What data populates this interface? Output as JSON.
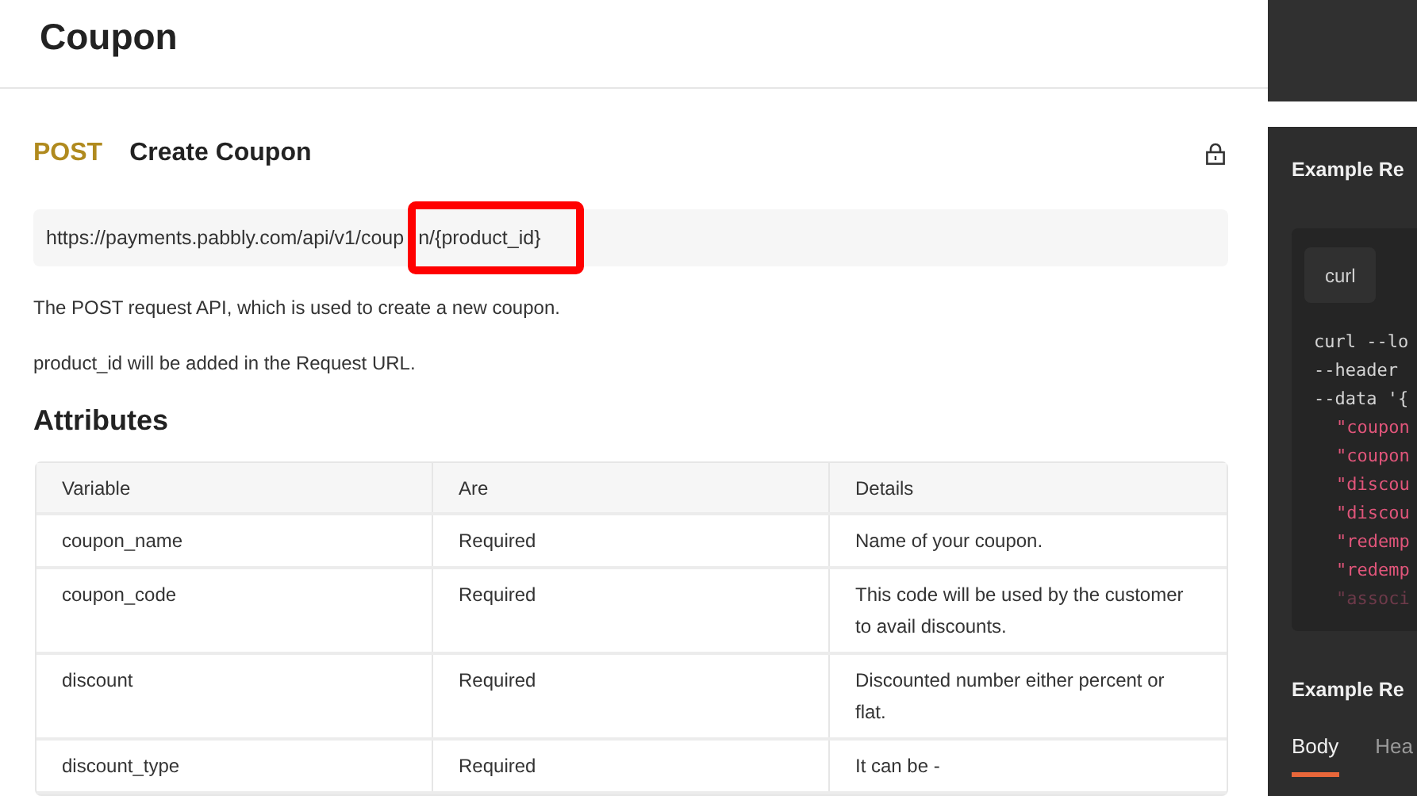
{
  "page_title": "Coupon",
  "endpoint": {
    "method": "POST",
    "title": "Create Coupon",
    "url_parts": [
      "https://payments.pabbly.com/api/v1/coup",
      "n/{product_id}"
    ],
    "highlight": true
  },
  "description": [
    "The POST request API, which is used to create a new coupon.",
    "product_id will be added in the Request URL."
  ],
  "attributes": {
    "title": "Attributes",
    "columns": [
      "Variable",
      "Are",
      "Details"
    ],
    "rows": [
      [
        "coupon_name",
        "Required",
        "Name of your coupon."
      ],
      [
        "coupon_code",
        "Required",
        "This code will be used by the customer to avail discounts."
      ],
      [
        "discount",
        "Required",
        "Discounted number either percent or flat."
      ],
      [
        "discount_type",
        "Required",
        "It can be -"
      ]
    ]
  },
  "example_request": {
    "title": "Example Re",
    "tabs": [
      {
        "label": "curl",
        "selected": true
      }
    ],
    "code_lines": [
      {
        "kind": "plain",
        "text": "curl --lo",
        "faded": false
      },
      {
        "kind": "plain",
        "text": "--header",
        "faded": false
      },
      {
        "kind": "plain",
        "text": "--data '{",
        "faded": false
      },
      {
        "kind": "key",
        "text": "\"coupon",
        "faded": false
      },
      {
        "kind": "key",
        "text": "\"coupon",
        "faded": false
      },
      {
        "kind": "key",
        "text": "\"discou",
        "faded": false
      },
      {
        "kind": "key",
        "text": "\"discou",
        "faded": false
      },
      {
        "kind": "key",
        "text": "\"redemp",
        "faded": false
      },
      {
        "kind": "key",
        "text": "\"redemp",
        "faded": false
      },
      {
        "kind": "key",
        "text": "\"associ",
        "faded": true
      }
    ]
  },
  "example_response": {
    "title": "Example Re",
    "tabs": [
      {
        "label": "Body",
        "selected": true
      },
      {
        "label": "Hea",
        "selected": false
      }
    ]
  }
}
